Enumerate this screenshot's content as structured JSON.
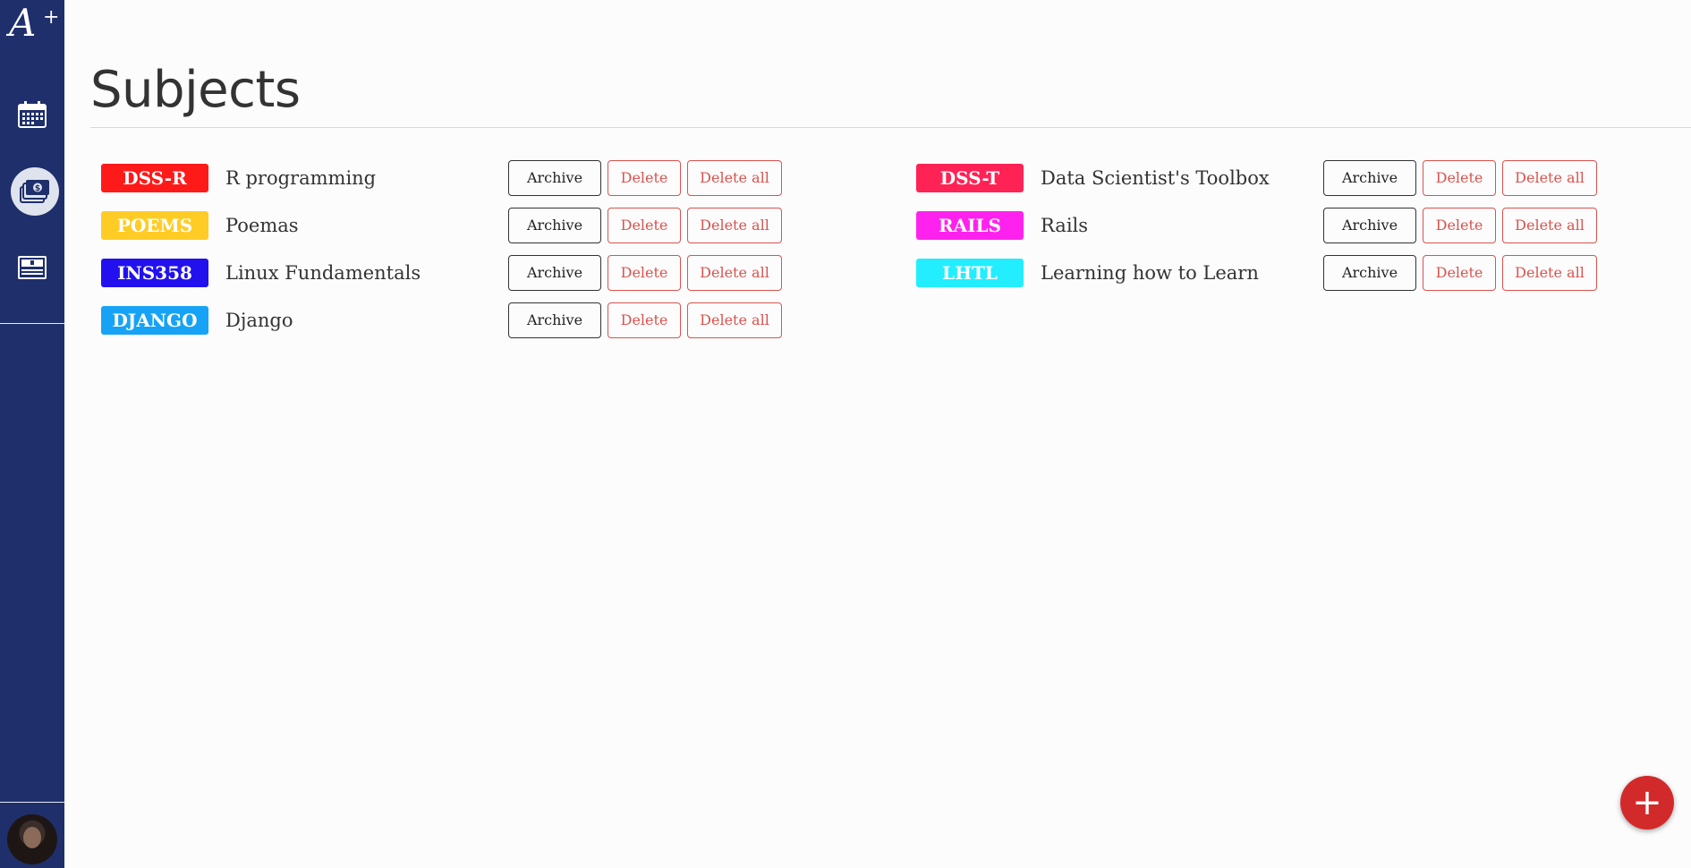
{
  "app": {
    "logo_text": "A",
    "logo_plus": "+"
  },
  "sidebar": {
    "items": [
      {
        "name": "calendar",
        "icon": "calendar-icon",
        "active": false
      },
      {
        "name": "subjects",
        "icon": "money-stack-icon",
        "active": true
      },
      {
        "name": "cards",
        "icon": "card-icon",
        "active": false
      }
    ]
  },
  "page": {
    "title": "Subjects"
  },
  "buttons": {
    "archive": "Archive",
    "delete": "Delete",
    "delete_all": "Delete all"
  },
  "subjects_left": [
    {
      "code": "DSS-R",
      "name": "R programming",
      "color": "#ff1a1a"
    },
    {
      "code": "POEMS",
      "name": "Poemas",
      "color": "#ffcc26"
    },
    {
      "code": "INS358",
      "name": "Linux Fundamentals",
      "color": "#2211ee"
    },
    {
      "code": "DJANGO",
      "name": "Django",
      "color": "#17a3f5"
    }
  ],
  "subjects_right": [
    {
      "code": "DSS-T",
      "name": "Data Scientist's Toolbox",
      "color": "#ff2255"
    },
    {
      "code": "RAILS",
      "name": "Rails",
      "color": "#ff22ee"
    },
    {
      "code": "LHTL",
      "name": "Learning how to Learn",
      "color": "#22eeff"
    }
  ],
  "fab": {
    "label": "+"
  }
}
